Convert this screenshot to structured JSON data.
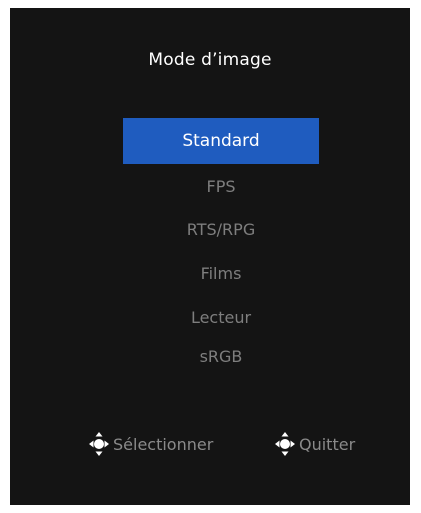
{
  "osd": {
    "title": "Mode d’image",
    "items": [
      {
        "label": "Standard",
        "selected": true
      },
      {
        "label": "FPS",
        "selected": false
      },
      {
        "label": "RTS/RPG",
        "selected": false
      },
      {
        "label": "Films",
        "selected": false
      },
      {
        "label": "Lecteur",
        "selected": false
      },
      {
        "label": "sRGB",
        "selected": false
      }
    ],
    "hints": {
      "select": {
        "label": "Sélectionner",
        "icon": "joystick-icon"
      },
      "exit": {
        "label": "Quitter",
        "icon": "joystick-icon"
      }
    }
  },
  "colors": {
    "panel_bg": "#141414",
    "highlight": "#1f5cbf",
    "text_active": "#ffffff",
    "text_inactive": "#7e7e7e"
  }
}
